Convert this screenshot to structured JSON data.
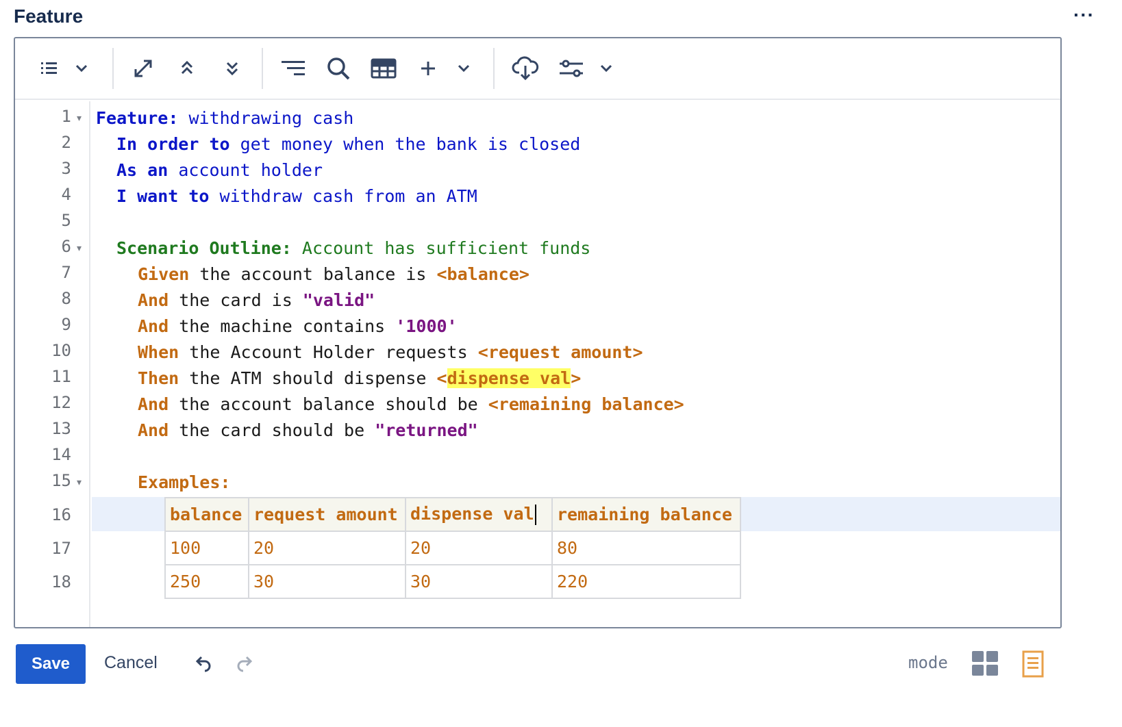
{
  "panel": {
    "title": "Feature",
    "more_glyph": "···"
  },
  "toolbar": {
    "icons": [
      "list-icon",
      "chevron-down-icon",
      "expand-icon",
      "collapse-up-icon",
      "collapse-down-icon",
      "format-lines-icon",
      "search-icon",
      "table-icon",
      "plus-icon",
      "chevron-down-icon",
      "cloud-download-icon",
      "settings-sliders-icon",
      "chevron-down-icon"
    ]
  },
  "editor": {
    "line_numbers": [
      "1",
      "2",
      "3",
      "4",
      "5",
      "6",
      "7",
      "8",
      "9",
      "10",
      "11",
      "12",
      "13",
      "14",
      "15",
      "16",
      "17",
      "18"
    ],
    "fold_marker": "▾",
    "lines": {
      "l1": {
        "kw": "Feature:",
        "text": " withdrawing cash"
      },
      "l2": {
        "kw1": "In order to",
        "text1": " get money when the bank is closed"
      },
      "l3": {
        "kw1": "As an",
        "text1": " account holder"
      },
      "l4": {
        "kw1": "I want to",
        "text1": " withdraw cash from an ATM"
      },
      "l6": {
        "kw": "Scenario Outline:",
        "text": " Account has sufficient funds"
      },
      "l7": {
        "kw": "Given",
        "text": " the account balance is ",
        "ph": "<balance>"
      },
      "l8": {
        "kw": "And",
        "text": " the card is ",
        "str": "\"valid\""
      },
      "l9": {
        "kw": "And",
        "text": " the machine contains ",
        "str": "'1000'"
      },
      "l10": {
        "kw": "When",
        "text": " the Account Holder requests ",
        "ph": "<request amount>"
      },
      "l11": {
        "kw": "Then",
        "text": " the ATM should dispense ",
        "ph_open": "<",
        "ph_hl": "dispense val",
        "ph_close": ">"
      },
      "l12": {
        "kw": "And",
        "text": " the account balance should be ",
        "ph": "<remaining balance>"
      },
      "l13": {
        "kw": "And",
        "text": " the card should be ",
        "str": "\"returned\""
      },
      "l15": {
        "kw": "Examples:"
      }
    },
    "examples": {
      "headers": [
        "balance",
        "request amount",
        "dispense val",
        "remaining balance"
      ],
      "rows": [
        [
          "100",
          "20",
          "20",
          "80"
        ],
        [
          "250",
          "30",
          "30",
          "220"
        ]
      ]
    }
  },
  "footer": {
    "save_label": "Save",
    "cancel_label": "Cancel",
    "mode_label": "mode"
  },
  "colors": {
    "keyword_blue": "#0b16c8",
    "keyword_green": "#1f7a1f",
    "keyword_orange": "#c26a12",
    "string_purple": "#7a1582",
    "highlight": "#ffff66",
    "save_button": "#1f5ccc"
  }
}
